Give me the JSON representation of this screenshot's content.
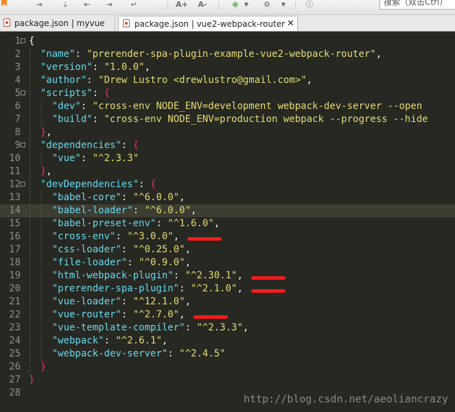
{
  "toolbar": {
    "search_placeholder": "搜索（双击Ctrl）",
    "buttons": [
      {
        "name": "bookmark-icon"
      },
      {
        "name": "indent-icon"
      },
      {
        "name": "download-icon"
      },
      {
        "name": "collapse-left-icon"
      },
      {
        "name": "expand-right-icon"
      },
      {
        "name": "word-wrap-icon"
      },
      {
        "name": "font-increase-icon",
        "label": "A+"
      },
      {
        "name": "font-decrease-icon",
        "label": "A-"
      },
      {
        "name": "add-plugin-icon"
      },
      {
        "name": "plugin-dropdown-icon"
      },
      {
        "name": "settings-icon"
      },
      {
        "name": "settings-dropdown-icon"
      },
      {
        "name": "info-icon"
      }
    ]
  },
  "tabs": [
    {
      "label": "package.json | myvue",
      "active": false
    },
    {
      "label": "package.json | vue2-webpack-router",
      "active": true,
      "close": "✕"
    }
  ],
  "editor": {
    "current_line": 14,
    "lines": [
      {
        "n": "1",
        "fold": true,
        "indent": 0,
        "tokens": [
          [
            "p",
            "{"
          ]
        ]
      },
      {
        "n": "2",
        "fold": false,
        "indent": 1,
        "tokens": [
          [
            "k",
            "\"name\""
          ],
          [
            "p",
            ": "
          ],
          [
            "s",
            "\"prerender-spa-plugin-example-vue2-webpack-router\""
          ],
          [
            "p",
            ","
          ]
        ]
      },
      {
        "n": "3",
        "fold": false,
        "indent": 1,
        "tokens": [
          [
            "k",
            "\"version\""
          ],
          [
            "p",
            ": "
          ],
          [
            "s",
            "\"1.0.0\""
          ],
          [
            "p",
            ","
          ]
        ]
      },
      {
        "n": "4",
        "fold": false,
        "indent": 1,
        "tokens": [
          [
            "k",
            "\"author\""
          ],
          [
            "p",
            ": "
          ],
          [
            "s",
            "\"Drew Lustro <drewlustro@gmail.com>\""
          ],
          [
            "p",
            ","
          ]
        ]
      },
      {
        "n": "5",
        "fold": true,
        "indent": 1,
        "tokens": [
          [
            "k",
            "\"scripts\""
          ],
          [
            "p",
            ": "
          ],
          [
            "pk",
            "{"
          ]
        ]
      },
      {
        "n": "6",
        "fold": false,
        "indent": 2,
        "tokens": [
          [
            "k",
            "\"dev\""
          ],
          [
            "p",
            ": "
          ],
          [
            "s",
            "\"cross-env NODE_ENV=development webpack-dev-server --open"
          ]
        ]
      },
      {
        "n": "7",
        "fold": false,
        "indent": 2,
        "tokens": [
          [
            "k",
            "\"build\""
          ],
          [
            "p",
            ": "
          ],
          [
            "s",
            "\"cross-env NODE_ENV=production webpack --progress --hide"
          ]
        ]
      },
      {
        "n": "8",
        "fold": false,
        "indent": 1,
        "tokens": [
          [
            "pk",
            "}"
          ],
          [
            "p",
            ","
          ]
        ]
      },
      {
        "n": "9",
        "fold": true,
        "indent": 1,
        "tokens": [
          [
            "k",
            "\"dependencies\""
          ],
          [
            "p",
            ": "
          ],
          [
            "pk",
            "{"
          ]
        ]
      },
      {
        "n": "10",
        "fold": false,
        "indent": 2,
        "tokens": [
          [
            "k",
            "\"vue\""
          ],
          [
            "p",
            ": "
          ],
          [
            "s",
            "\"^2.3.3\""
          ]
        ]
      },
      {
        "n": "11",
        "fold": false,
        "indent": 1,
        "tokens": [
          [
            "pk",
            "}"
          ],
          [
            "p",
            ","
          ]
        ]
      },
      {
        "n": "12",
        "fold": true,
        "indent": 1,
        "tokens": [
          [
            "k",
            "\"devDependencies\""
          ],
          [
            "p",
            ": "
          ],
          [
            "pk",
            "{"
          ]
        ]
      },
      {
        "n": "13",
        "fold": false,
        "indent": 2,
        "tokens": [
          [
            "k",
            "\"babel-core\""
          ],
          [
            "p",
            ": "
          ],
          [
            "s",
            "\"^6.0.0\""
          ],
          [
            "p",
            ","
          ]
        ]
      },
      {
        "n": "14",
        "fold": false,
        "indent": 2,
        "tokens": [
          [
            "k",
            "\"babel-loader\""
          ],
          [
            "p",
            ": "
          ],
          [
            "s",
            "\"^6.0.0\""
          ],
          [
            "p",
            ","
          ]
        ]
      },
      {
        "n": "15",
        "fold": false,
        "indent": 2,
        "tokens": [
          [
            "k",
            "\"babel-preset-env\""
          ],
          [
            "p",
            ": "
          ],
          [
            "s",
            "\"^1.6.0\""
          ],
          [
            "p",
            ","
          ]
        ]
      },
      {
        "n": "16",
        "fold": false,
        "indent": 2,
        "tokens": [
          [
            "k",
            "\"cross-env\""
          ],
          [
            "p",
            ": "
          ],
          [
            "s",
            "\"^3.0.0\""
          ],
          [
            "p",
            ","
          ]
        ]
      },
      {
        "n": "17",
        "fold": false,
        "indent": 2,
        "tokens": [
          [
            "k",
            "\"css-loader\""
          ],
          [
            "p",
            ": "
          ],
          [
            "s",
            "\"^0.25.0\""
          ],
          [
            "p",
            ","
          ]
        ]
      },
      {
        "n": "18",
        "fold": false,
        "indent": 2,
        "tokens": [
          [
            "k",
            "\"file-loader\""
          ],
          [
            "p",
            ": "
          ],
          [
            "s",
            "\"^0.9.0\""
          ],
          [
            "p",
            ","
          ]
        ]
      },
      {
        "n": "19",
        "fold": false,
        "indent": 2,
        "tokens": [
          [
            "k",
            "\"html-webpack-plugin\""
          ],
          [
            "p",
            ": "
          ],
          [
            "s",
            "\"^2.30.1\""
          ],
          [
            "p",
            ","
          ]
        ]
      },
      {
        "n": "20",
        "fold": false,
        "indent": 2,
        "tokens": [
          [
            "k",
            "\"prerender-spa-plugin\""
          ],
          [
            "p",
            ": "
          ],
          [
            "s",
            "\"^2.1.0\""
          ],
          [
            "p",
            ","
          ]
        ]
      },
      {
        "n": "21",
        "fold": false,
        "indent": 2,
        "tokens": [
          [
            "k",
            "\"vue-loader\""
          ],
          [
            "p",
            ": "
          ],
          [
            "s",
            "\"^12.1.0\""
          ],
          [
            "p",
            ","
          ]
        ]
      },
      {
        "n": "22",
        "fold": false,
        "indent": 2,
        "tokens": [
          [
            "k",
            "\"vue-router\""
          ],
          [
            "p",
            ": "
          ],
          [
            "s",
            "\"^2.7.0\""
          ],
          [
            "p",
            ","
          ]
        ]
      },
      {
        "n": "23",
        "fold": false,
        "indent": 2,
        "tokens": [
          [
            "k",
            "\"vue-template-compiler\""
          ],
          [
            "p",
            ": "
          ],
          [
            "s",
            "\"^2.3.3\""
          ],
          [
            "p",
            ","
          ]
        ]
      },
      {
        "n": "24",
        "fold": false,
        "indent": 2,
        "tokens": [
          [
            "k",
            "\"webpack\""
          ],
          [
            "p",
            ": "
          ],
          [
            "s",
            "\"^2.6.1\""
          ],
          [
            "p",
            ","
          ]
        ]
      },
      {
        "n": "25",
        "fold": false,
        "indent": 2,
        "tokens": [
          [
            "k",
            "\"webpack-dev-server\""
          ],
          [
            "p",
            ": "
          ],
          [
            "s",
            "\"^2.4.5\""
          ]
        ]
      },
      {
        "n": "26",
        "fold": false,
        "indent": 1,
        "tokens": [
          [
            "pk",
            "}"
          ]
        ]
      },
      {
        "n": "27",
        "fold": false,
        "indent": 0,
        "tokens": [
          [
            "pk",
            "}"
          ]
        ]
      },
      {
        "n": "28",
        "fold": false,
        "indent": 0,
        "tokens": []
      }
    ]
  },
  "annotations": [
    {
      "line": 16,
      "name": "red-underline-cross-env"
    },
    {
      "line": 19,
      "name": "red-underline-html-webpack-plugin"
    },
    {
      "line": 20,
      "name": "red-underline-prerender-spa-plugin"
    },
    {
      "line": 22,
      "name": "red-underline-vue-router"
    }
  ],
  "watermark": "http://blog.csdn.net/aeoliancrazy",
  "colors": {
    "background": "#272822",
    "current_line": "#3e3d32",
    "key": "#66d9ef",
    "string": "#e6db74",
    "brace": "#f92672",
    "annotation": "#ff1a1a"
  }
}
